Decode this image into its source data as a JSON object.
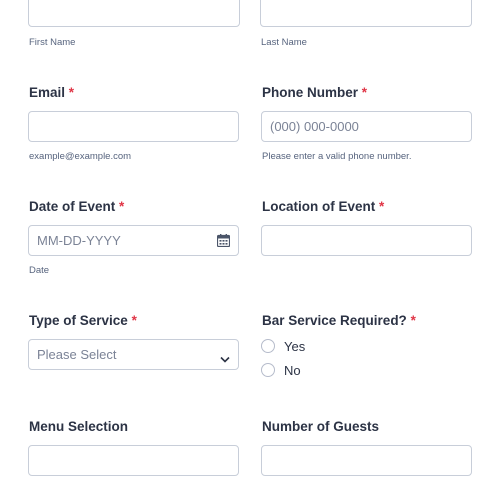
{
  "name_row": {
    "first_sublabel": "First Name",
    "last_sublabel": "Last Name"
  },
  "email": {
    "label": "Email",
    "required_mark": "*",
    "value": "",
    "sublabel": "example@example.com"
  },
  "phone": {
    "label": "Phone Number",
    "required_mark": "*",
    "placeholder": "(000) 000-0000",
    "sublabel": "Please enter a valid phone number."
  },
  "date": {
    "label": "Date of Event",
    "required_mark": "*",
    "placeholder": "MM-DD-YYYY",
    "sublabel": "Date",
    "icon": "calendar-icon"
  },
  "location": {
    "label": "Location of Event",
    "required_mark": "*",
    "value": ""
  },
  "service": {
    "label": "Type of Service",
    "required_mark": "*",
    "selected": "Please Select",
    "icon": "chevron-down-icon"
  },
  "bar": {
    "label": "Bar Service Required?",
    "required_mark": "*",
    "options": [
      {
        "label": "Yes",
        "checked": false
      },
      {
        "label": "No",
        "checked": false
      }
    ]
  },
  "menu": {
    "label": "Menu Selection",
    "value": ""
  },
  "guests": {
    "label": "Number of Guests",
    "value": ""
  },
  "colors": {
    "required": "#e03546",
    "text": "#2c3345",
    "border": "#c8ced9"
  }
}
